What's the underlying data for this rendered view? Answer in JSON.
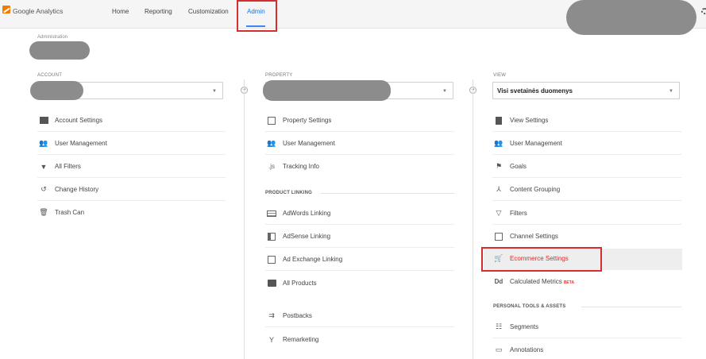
{
  "topbar": {
    "brand": "Google Analytics",
    "nav": [
      "Home",
      "Reporting",
      "Customization"
    ],
    "active": "Admin"
  },
  "admin_label": "Administration",
  "account": {
    "label": "ACCOUNT",
    "items": [
      "Account Settings",
      "User Management",
      "All Filters",
      "Change History",
      "Trash Can"
    ]
  },
  "property": {
    "label": "PROPERTY",
    "items": [
      "Property Settings",
      "User Management",
      "Tracking Info"
    ],
    "section": "PRODUCT LINKING",
    "linking": [
      "AdWords Linking",
      "AdSense Linking",
      "Ad Exchange Linking",
      "All Products"
    ],
    "extra": [
      "Postbacks",
      "Remarketing"
    ]
  },
  "view": {
    "label": "VIEW",
    "selected": "Visi svetainės duomenys",
    "items": [
      "View Settings",
      "User Management",
      "Goals",
      "Content Grouping",
      "Filters",
      "Channel Settings",
      "Ecommerce Settings",
      "Calculated Metrics"
    ],
    "beta": "BETA",
    "section": "PERSONAL TOOLS & ASSETS",
    "tools": [
      "Segments",
      "Annotations"
    ]
  },
  "colors": {
    "accent": "#1a73e8",
    "highlight": "#d32f2f",
    "logo": "#f57c00"
  }
}
